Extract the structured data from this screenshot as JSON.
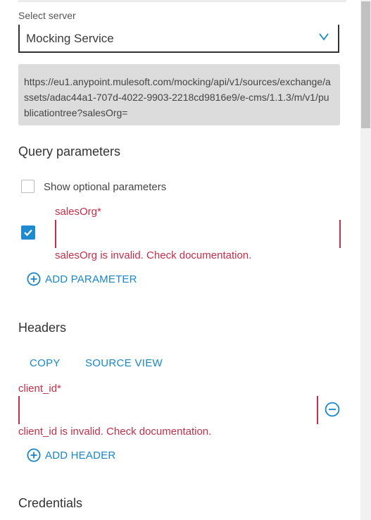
{
  "server": {
    "label": "Select server",
    "selected": "Mocking Service"
  },
  "request_url": "https://eu1.anypoint.mulesoft.com/mocking/api/v1/sources/exchange/assets/adac44a1-707d-4022-9903-2218cd9816e9/e-cms/1.1.3/m/v1/publicationtree?salesOrg=",
  "query": {
    "title": "Query parameters",
    "optional_label": "Show optional parameters",
    "param_name": "salesOrg*",
    "param_value": "",
    "param_error": "salesOrg is invalid. Check documentation.",
    "add_label": "ADD PARAMETER"
  },
  "headers": {
    "title": "Headers",
    "copy_label": "COPY",
    "source_view_label": "SOURCE VIEW",
    "header_name": "client_id*",
    "header_value": "",
    "header_error": "client_id is invalid. Check documentation.",
    "add_label": "ADD HEADER"
  },
  "credentials": {
    "title": "Credentials"
  },
  "colors": {
    "accent": "#1a86c6",
    "error": "#c0304a",
    "checkbox": "#1e8ad0"
  }
}
